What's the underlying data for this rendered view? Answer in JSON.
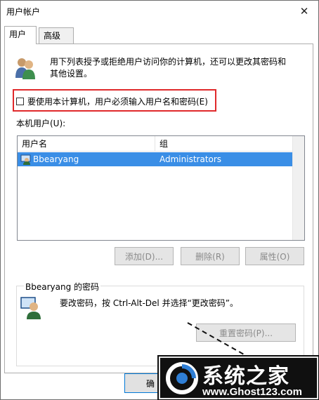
{
  "window": {
    "title": "用户帐户",
    "close_glyph": "✕"
  },
  "tabs": [
    {
      "label": "用户",
      "active": true
    },
    {
      "label": "高级",
      "active": false
    }
  ],
  "intro": {
    "text": "用下列表授予或拒绝用户访问你的计算机，还可以更改其密码和其他设置。",
    "icon": "users-icon"
  },
  "require_login": {
    "label": "要使用本计算机，用户必须输入用户名和密码(E)",
    "checked": false
  },
  "local_users": {
    "label": "本机用户(U):",
    "columns": [
      "用户名",
      "组"
    ],
    "rows": [
      {
        "name": "Bbearyang",
        "group": "Administrators",
        "selected": true
      }
    ]
  },
  "buttons": {
    "add": "添加(D)...",
    "delete": "删除(R)",
    "properties": "属性(O)",
    "reset_password": "重置密码(P)...",
    "ok": "确"
  },
  "password_group": {
    "title": "Bbearyang 的密码",
    "text": "要改密码，按 Ctrl-Alt-Del 并选择“更改密码”。"
  },
  "watermark": {
    "title": "系统之家",
    "url": "www.Ghost123.com"
  },
  "colors": {
    "selection": "#3a8ee6",
    "highlight_border": "#e0292b",
    "disabled_text": "#8a8a8a"
  }
}
